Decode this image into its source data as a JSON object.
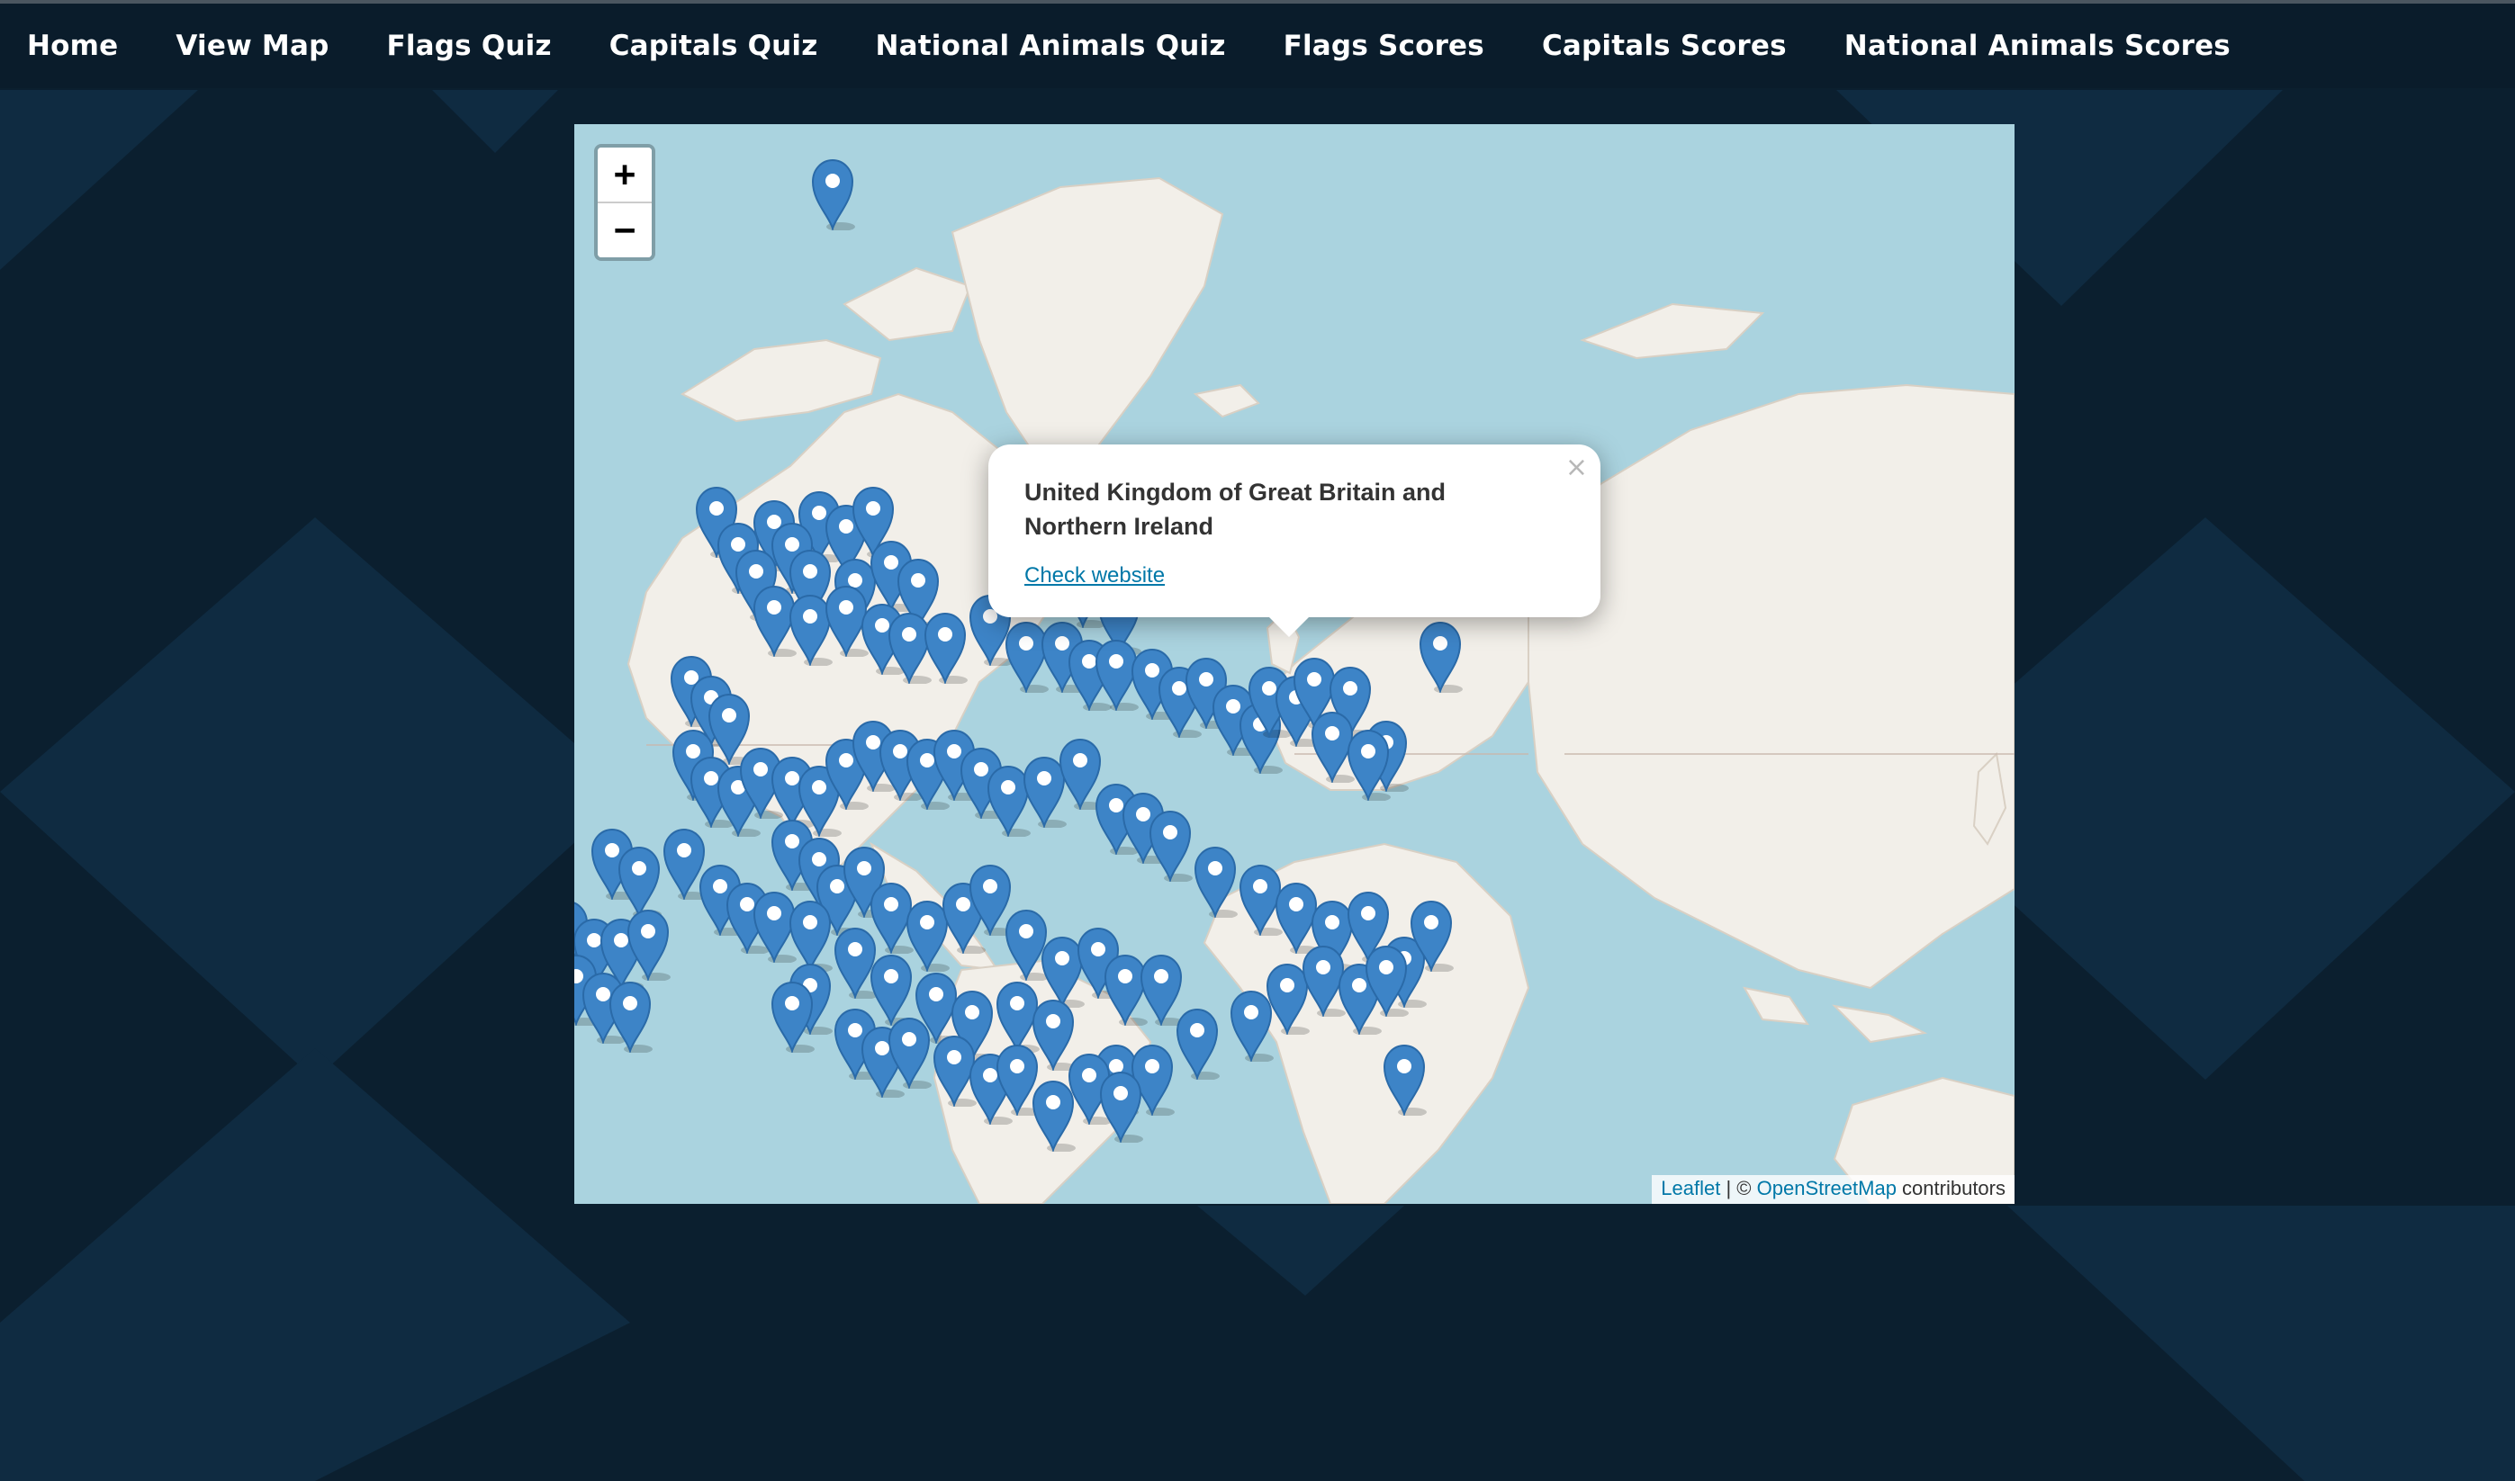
{
  "nav": {
    "items": [
      {
        "label": "Home"
      },
      {
        "label": "View Map"
      },
      {
        "label": "Flags Quiz"
      },
      {
        "label": "Capitals Quiz"
      },
      {
        "label": "National Animals Quiz"
      },
      {
        "label": "Flags Scores"
      },
      {
        "label": "Capitals Scores"
      },
      {
        "label": "National Animals Scores"
      }
    ]
  },
  "map": {
    "zoom_in_label": "+",
    "zoom_out_label": "−",
    "popup": {
      "title": "United Kingdom of Great Britain and Northern Ireland",
      "link_text": "Check website",
      "close_label": "×"
    },
    "attribution": {
      "leaflet": "Leaflet",
      "separator": " | © ",
      "osm": "OpenStreetMap",
      "suffix": " contributors"
    },
    "marker_icon": "map-pin-icon",
    "colors": {
      "ocean": "#aad3df",
      "land": "#f2efe9",
      "marker": "#3d84c7",
      "page_background": "#0b1f2f"
    }
  }
}
